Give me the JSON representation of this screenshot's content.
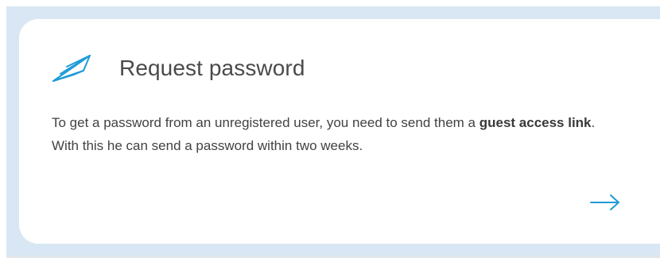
{
  "card": {
    "title": "Request password",
    "description": {
      "part1": "To get a password from an unregistered user, you need to send them a ",
      "bold": "guest access link",
      "part2": ". With this he can send a password within two weeks."
    },
    "icon": "paper-plane-icon",
    "action_icon": "arrow-right-icon"
  },
  "colors": {
    "accent": "#1e9bd7",
    "frame_background": "#d8e7f3",
    "card_background": "#ffffff",
    "text": "#424242"
  }
}
